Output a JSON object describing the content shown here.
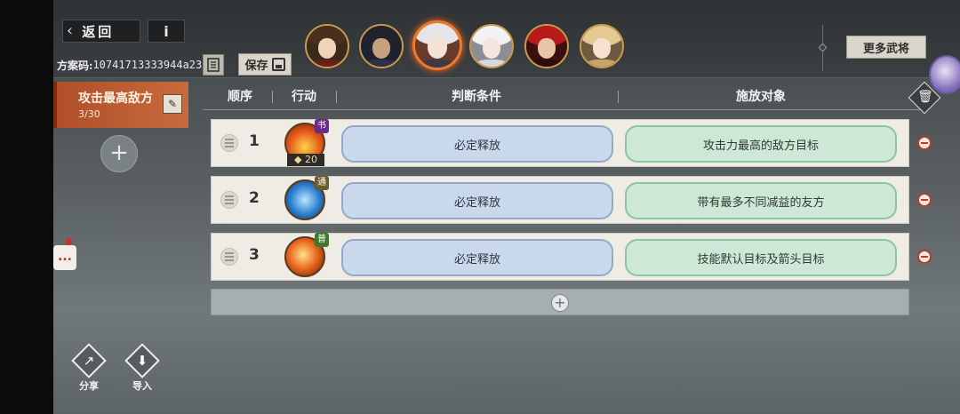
{
  "header": {
    "back_label": "返回",
    "info_label": "i",
    "plan_code_label": "方案码:",
    "plan_code_value": "10741713333944a23",
    "save_label": "保存",
    "more_generals_label": "更多武将"
  },
  "plans": {
    "active_name": "攻击最高敌方",
    "active_count": "3/30",
    "add_label": "+"
  },
  "columns": {
    "order": "顺序",
    "action": "行动",
    "condition": "判断条件",
    "target": "施放对象"
  },
  "rows": [
    {
      "order": "1",
      "cost": "20",
      "condition": "必定释放",
      "target": "攻击力最高的敌方目标",
      "tag": "书"
    },
    {
      "order": "2",
      "cost": "",
      "condition": "必定释放",
      "target": "带有最多不同减益的友方",
      "tag": "通"
    },
    {
      "order": "3",
      "cost": "",
      "condition": "必定释放",
      "target": "技能默认目标及箭头目标",
      "tag": "普"
    }
  ],
  "tools": {
    "share_label": "分享",
    "import_label": "导入"
  },
  "chat": {
    "label": "..."
  },
  "icons": {
    "back": "chevron-left-icon",
    "copy": "copy-icon",
    "save": "save-icon",
    "edit": "pencil-icon",
    "trash": "trash-icon",
    "remove": "minus-circle-icon",
    "add": "plus-icon",
    "share": "share-icon",
    "import": "import-icon"
  },
  "colors": {
    "accent_orange": "#c0603a",
    "condition_blue": "#c9d8ea",
    "target_green": "#cde8d6",
    "remove_red": "#c0392b"
  }
}
